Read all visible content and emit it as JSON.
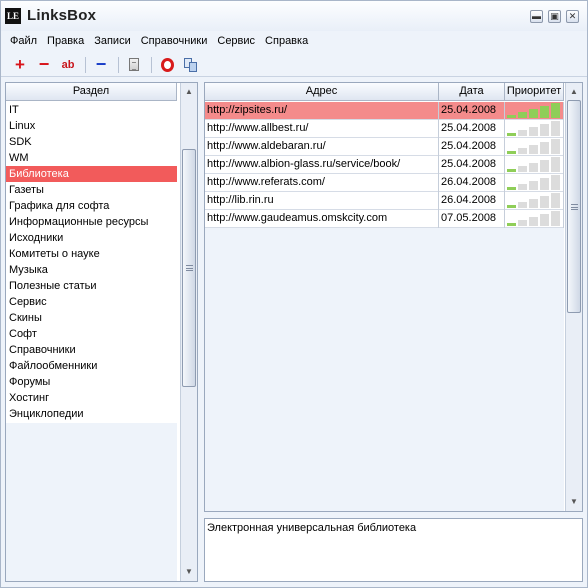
{
  "app": {
    "logo_text": "LE",
    "title": "LinksBox"
  },
  "window_controls": {
    "minimize": "▬",
    "maximize": "▣",
    "close": "✕"
  },
  "menu": [
    "Файл",
    "Правка",
    "Записи",
    "Справочники",
    "Сервис",
    "Справка"
  ],
  "toolbar": [
    {
      "name": "add-button",
      "icon": "plus-icon",
      "glyph": "+"
    },
    {
      "name": "delete-button",
      "icon": "minus-icon",
      "glyph": "−"
    },
    {
      "name": "rename-button",
      "icon": "ab-icon",
      "glyph": "ab"
    },
    {
      "name": "remove-link-button",
      "icon": "blue-minus-icon",
      "glyph": "−"
    },
    {
      "name": "properties-button",
      "icon": "document-icon",
      "glyph": ""
    },
    {
      "name": "open-in-opera-button",
      "icon": "opera-icon",
      "glyph": ""
    },
    {
      "name": "copy-button",
      "icon": "copy-icon",
      "glyph": ""
    }
  ],
  "sections": {
    "header": "Раздел",
    "items": [
      "IT",
      "Linux",
      "SDK",
      "WM",
      "Библиотека",
      "Газеты",
      "Графика для софта",
      "Информационные ресурсы",
      "Исходники",
      "Комитеты о науке",
      "Музыка",
      "Полезные статьи",
      "Сервис",
      "Скины",
      "Софт",
      "Справочники",
      "Файлообменники",
      "Форумы",
      "Хостинг",
      "Энциклопедии"
    ],
    "selected_index": 4
  },
  "links": {
    "columns": {
      "address": "Адрес",
      "date": "Дата",
      "priority": "Приоритет"
    },
    "rows": [
      {
        "url": "http://zipsites.ru/",
        "date": "25.04.2008",
        "priority": 5
      },
      {
        "url": "http://www.allbest.ru/",
        "date": "25.04.2008",
        "priority": 1
      },
      {
        "url": "http://www.aldebaran.ru/",
        "date": "25.04.2008",
        "priority": 1
      },
      {
        "url": "http://www.albion-glass.ru/service/book/",
        "date": "25.04.2008",
        "priority": 1
      },
      {
        "url": "http://www.referats.com/",
        "date": "26.04.2008",
        "priority": 1
      },
      {
        "url": "http://lib.rin.ru",
        "date": "26.04.2008",
        "priority": 1
      },
      {
        "url": "http://www.gaudeamus.omskcity.com",
        "date": "07.05.2008",
        "priority": 1
      }
    ],
    "selected_index": 0,
    "priority_max": 5,
    "colors": {
      "active": "#8fce58",
      "inactive": "#dcdcdc",
      "selected_row": "#f48b8b"
    }
  },
  "description": "Электронная универсальная библиотека",
  "colors": {
    "selected_section": "#f25b5b"
  }
}
